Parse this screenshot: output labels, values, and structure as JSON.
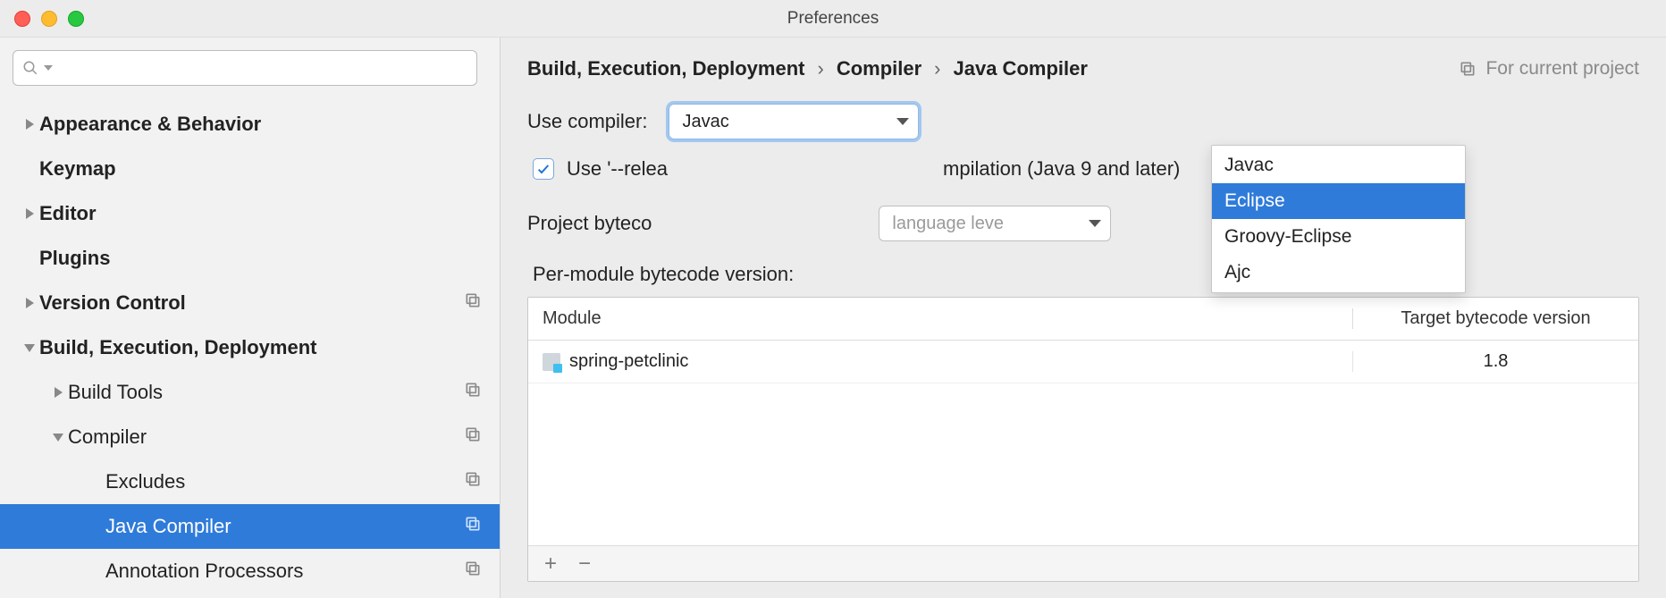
{
  "window": {
    "title": "Preferences"
  },
  "sidebar": {
    "search_placeholder": "",
    "items": [
      {
        "label": "Appearance & Behavior",
        "bold": true,
        "indent": 0,
        "disclosure": "right",
        "copy": false
      },
      {
        "label": "Keymap",
        "bold": true,
        "indent": 0,
        "disclosure": "none",
        "copy": false
      },
      {
        "label": "Editor",
        "bold": true,
        "indent": 0,
        "disclosure": "right",
        "copy": false
      },
      {
        "label": "Plugins",
        "bold": true,
        "indent": 0,
        "disclosure": "none",
        "copy": false
      },
      {
        "label": "Version Control",
        "bold": true,
        "indent": 0,
        "disclosure": "right",
        "copy": true
      },
      {
        "label": "Build, Execution, Deployment",
        "bold": true,
        "indent": 0,
        "disclosure": "down",
        "copy": false
      },
      {
        "label": "Build Tools",
        "bold": false,
        "indent": 1,
        "disclosure": "right",
        "copy": true
      },
      {
        "label": "Compiler",
        "bold": false,
        "indent": 1,
        "disclosure": "down",
        "copy": true
      },
      {
        "label": "Excludes",
        "bold": false,
        "indent": 2,
        "disclosure": "none",
        "copy": true
      },
      {
        "label": "Java Compiler",
        "bold": false,
        "indent": 2,
        "disclosure": "none",
        "copy": true,
        "selected": true
      },
      {
        "label": "Annotation Processors",
        "bold": false,
        "indent": 2,
        "disclosure": "none",
        "copy": true
      }
    ]
  },
  "breadcrumb": {
    "a": "Build, Execution, Deployment",
    "b": "Compiler",
    "c": "Java Compiler",
    "sep": "›"
  },
  "for_project": "For current project",
  "use_compiler": {
    "label": "Use compiler:",
    "value": "Javac",
    "options": [
      "Javac",
      "Eclipse",
      "Groovy-Eclipse",
      "Ajc"
    ],
    "highlighted": "Eclipse"
  },
  "release_checkbox": {
    "checked": true,
    "label_prefix": "Use '--relea",
    "label_suffix": "mpilation (Java 9 and later)"
  },
  "project_bytecode": {
    "label_prefix": "Project byteco",
    "placeholder": "language leve"
  },
  "per_module_label_partial": "Per-module bytecode version:",
  "table": {
    "col_module": "Module",
    "col_version": "Target bytecode version",
    "rows": [
      {
        "module": "spring-petclinic",
        "version": "1.8"
      }
    ]
  },
  "footer": {
    "plus": "+",
    "minus": "−"
  }
}
